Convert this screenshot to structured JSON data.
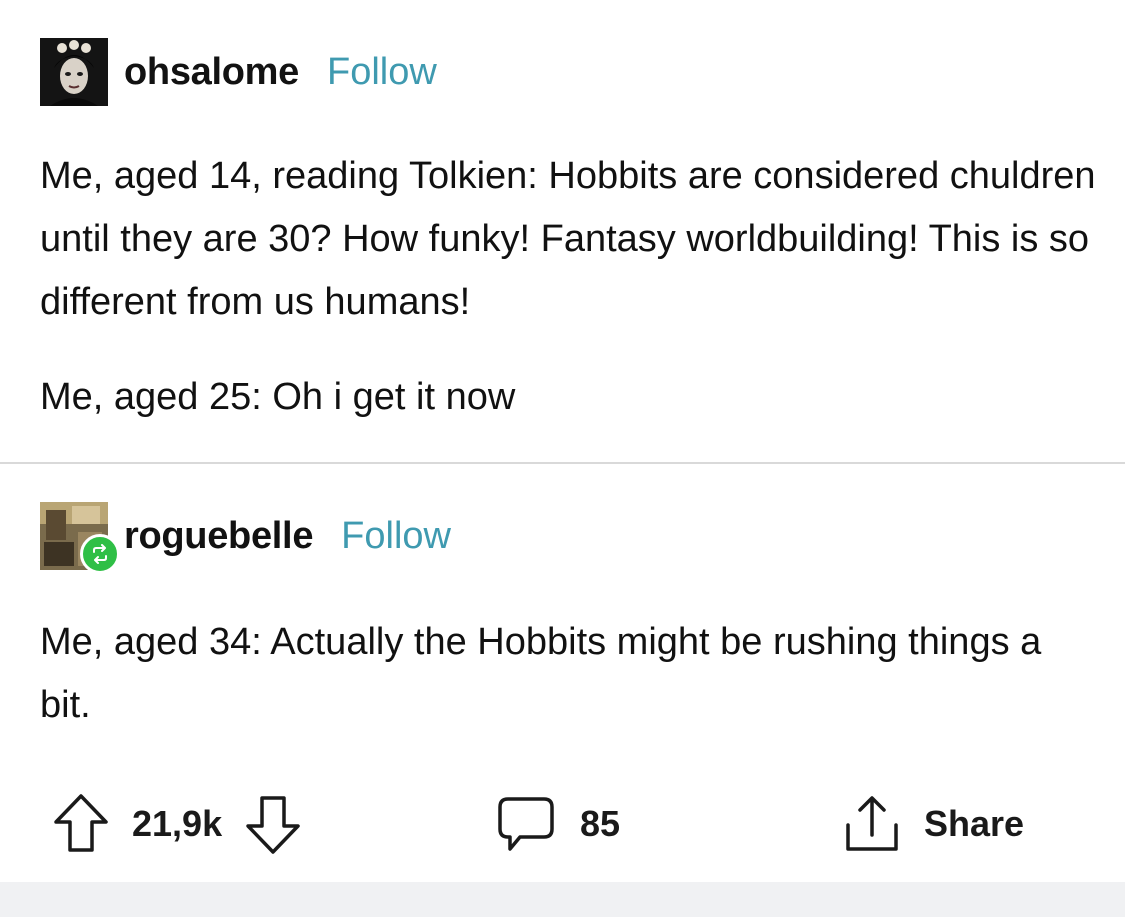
{
  "posts": [
    {
      "username": "ohsalome",
      "follow_label": "Follow",
      "paragraphs": [
        "Me, aged 14, reading Tolkien: Hobbits are considered chuldren until they are 30? How funky! Fantasy worldbuilding! This is so different from us humans!",
        "Me, aged 25: Oh i get it now"
      ]
    },
    {
      "username": "roguebelle",
      "follow_label": "Follow",
      "paragraphs": [
        "Me, aged 34: Actually the Hobbits might be rushing things a bit."
      ]
    }
  ],
  "actions": {
    "upvote_count": "21,9k",
    "comment_count": "85",
    "share_label": "Share"
  },
  "icons": {
    "upvote": "arrow-up-icon",
    "downvote": "arrow-down-icon",
    "comment": "speech-bubble-icon",
    "share": "share-icon",
    "reblog": "reblog-icon"
  },
  "colors": {
    "follow": "#3f9ab0",
    "text": "#111111",
    "divider": "#d9d9d9",
    "reblog_badge": "#2fbf46",
    "footer": "#f0f1f3"
  }
}
